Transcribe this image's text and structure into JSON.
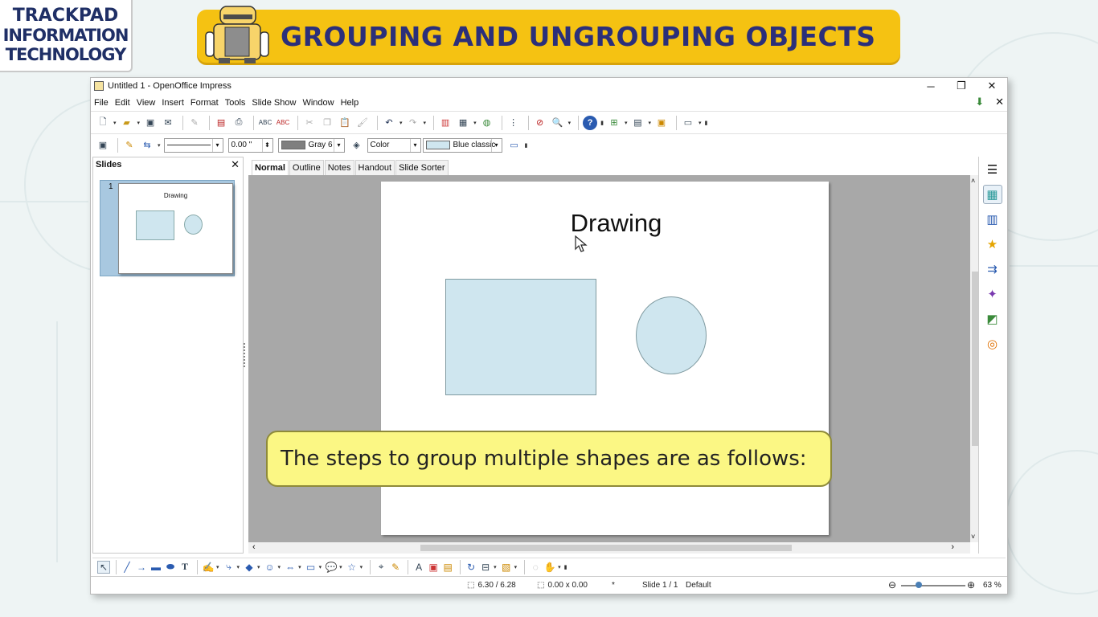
{
  "logo": {
    "line1": "TRACKPAD",
    "line2": "INFORMATION",
    "line3": "TECHNOLOGY"
  },
  "banner": {
    "title": "GROUPING AND UNGROUPING OBJECTS"
  },
  "window": {
    "title": "Untitled 1 - OpenOffice Impress",
    "controls": {
      "minimize": "─",
      "restore": "❐",
      "close": "✕"
    }
  },
  "menubar": {
    "items": [
      "File",
      "Edit",
      "View",
      "Insert",
      "Format",
      "Tools",
      "Slide Show",
      "Window",
      "Help"
    ],
    "doc_close": "✕"
  },
  "line_toolbar": {
    "line_width": "0.00 \"",
    "line_color": "Gray 6",
    "line_color_hex": "#7f7f7f",
    "area_style": "Color",
    "area_color": "Blue classic",
    "area_color_hex": "#cfe6ef"
  },
  "slides_panel": {
    "header": "Slides",
    "close": "✕",
    "thumbnails": [
      {
        "number": "1",
        "title": "Drawing"
      }
    ]
  },
  "view_tabs": [
    "Normal",
    "Outline",
    "Notes",
    "Handout",
    "Slide Sorter"
  ],
  "slide": {
    "title": "Drawing"
  },
  "statusbar": {
    "position": "6.30 / 6.28",
    "size": "0.00 x 0.00",
    "modified": "*",
    "slide_info": "Slide 1 / 1",
    "layout": "Default",
    "zoom": "63 %"
  },
  "caption": {
    "text": "The steps to group multiple shapes are as follows:"
  },
  "colors": {
    "banner": "#f5c212",
    "banner_text": "#2b2f7a",
    "caption_bg": "#fbf784",
    "shape_fill": "#cfe6ef",
    "workspace_bg": "#a8a8a8"
  }
}
